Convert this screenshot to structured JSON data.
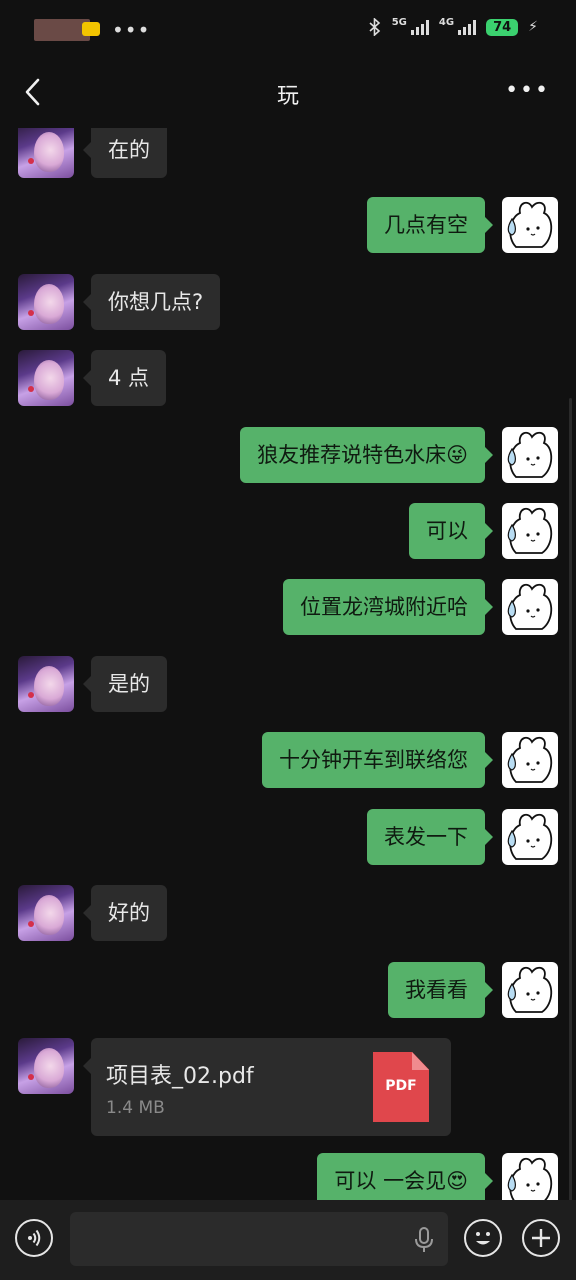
{
  "status_bar": {
    "dots": "•••",
    "network_1": "5G",
    "network_2": "4G",
    "battery": "74",
    "charging_icon": "bolt-icon",
    "bluetooth_icon": "bluetooth-icon"
  },
  "header": {
    "title": "玩",
    "back_icon": "chevron-left-icon",
    "more_label": "•••"
  },
  "messages": [
    {
      "side": "left",
      "text": "在的"
    },
    {
      "side": "right",
      "text": "几点有空"
    },
    {
      "side": "left",
      "text": "你想几点?"
    },
    {
      "side": "left",
      "text": "4 点"
    },
    {
      "side": "right",
      "text": "狼友推荐说特色水床😜"
    },
    {
      "side": "right",
      "text": "可以"
    },
    {
      "side": "right",
      "text": "位置龙湾城附近哈"
    },
    {
      "side": "left",
      "text": "是的"
    },
    {
      "side": "right",
      "text": "十分钟开车到联络您"
    },
    {
      "side": "right",
      "text": "表发一下"
    },
    {
      "side": "left",
      "text": "好的"
    },
    {
      "side": "right",
      "text": "我看看"
    },
    {
      "side": "left",
      "type": "file",
      "file_name": "项目表_02.pdf",
      "file_size": "1.4 MB",
      "file_icon_label": "PDF"
    },
    {
      "side": "right",
      "text": "可以 一会见😍"
    }
  ],
  "input_bar": {
    "placeholder": "",
    "voice_icon": "voice-icon",
    "mic_icon": "microphone-icon",
    "emoji_icon": "smiley-icon",
    "plus_icon": "plus-icon"
  },
  "colors": {
    "background": "#111111",
    "incoming_bubble": "#2c2c2c",
    "outgoing_bubble": "#56b26a",
    "pdf_icon": "#e0474c",
    "battery": "#3bd16f"
  }
}
